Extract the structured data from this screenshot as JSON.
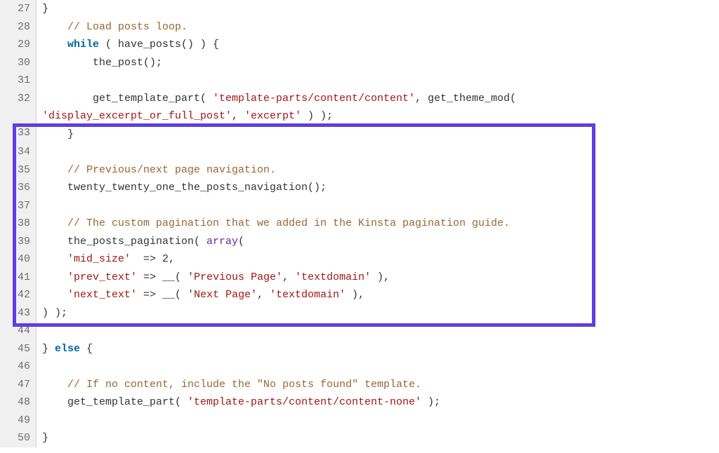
{
  "lines": {
    "l27": {
      "start": 27,
      "end": 50
    },
    "n27": "27",
    "n28": "28",
    "n29": "29",
    "n30": "30",
    "n31": "31",
    "n32": "32",
    "n33": "33",
    "n34": "34",
    "n35": "35",
    "n36": "36",
    "n37": "37",
    "n38": "38",
    "n39": "39",
    "n40": "40",
    "n41": "41",
    "n42": "42",
    "n43": "43",
    "n44": "44",
    "n45": "45",
    "n46": "46",
    "n47": "47",
    "n48": "48",
    "n49": "49",
    "n50": "50"
  },
  "code": {
    "l27_brace": "}",
    "l28_a": "    ",
    "l28_cmt": "// Load posts loop.",
    "l29_a": "    ",
    "l29_kw": "while",
    "l29_b": " ( have_posts() ) {",
    "l30_a": "        the_post();",
    "l32_a": "        get_template_part( ",
    "l32_s1": "'template-parts/content/content'",
    "l32_b": ", get_theme_mod( ",
    "l32w_s2": "'display_excerpt_or_full_post'",
    "l32w_b": ", ",
    "l32w_s3": "'excerpt'",
    "l32w_c": " ) );",
    "l33_a": "    }",
    "l35_a": "    ",
    "l35_cmt": "// Previous/next page navigation.",
    "l36_a": "    twenty_twenty_one_the_posts_navigation();",
    "l38_a": "    ",
    "l38_cmt": "// The custom pagination that we added in the Kinsta pagination guide.",
    "l39_a": "    the_posts_pagination( ",
    "l39_arr": "array",
    "l39_b": "(",
    "l40_a": "    ",
    "l40_s1": "'mid_size'",
    "l40_b": "  => ",
    "l40_n": "2",
    "l40_c": ",",
    "l41_a": "    ",
    "l41_s1": "'prev_text'",
    "l41_b": " => __( ",
    "l41_s2": "'Previous Page'",
    "l41_c": ", ",
    "l41_s3": "'textdomain'",
    "l41_d": " ),",
    "l42_a": "    ",
    "l42_s1": "'next_text'",
    "l42_b": " => __( ",
    "l42_s2": "'Next Page'",
    "l42_c": ", ",
    "l42_s3": "'textdomain'",
    "l42_d": " ),",
    "l43_a": ") );",
    "l45_a": "} ",
    "l45_kw": "else",
    "l45_b": " {",
    "l47_a": "    ",
    "l47_cmt": "// If no content, include the \"No posts found\" template.",
    "l48_a": "    get_template_part( ",
    "l48_s1": "'template-parts/content/content-none'",
    "l48_b": " );",
    "l50_a": "}"
  }
}
